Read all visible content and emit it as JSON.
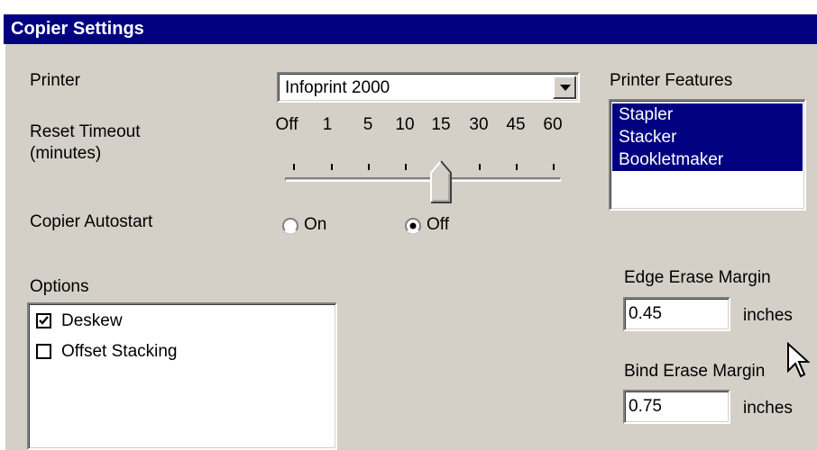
{
  "window": {
    "title": "Copier Settings"
  },
  "printer": {
    "label": "Printer",
    "selected": "Infoprint 2000"
  },
  "reset_timeout": {
    "label_line1": "Reset Timeout",
    "label_line2": "(minutes)",
    "ticks": [
      "Off",
      "1",
      "5",
      "10",
      "15",
      "30",
      "45",
      "60"
    ],
    "selected": "15"
  },
  "autostart": {
    "label": "Copier Autostart",
    "options": [
      {
        "label": "On",
        "selected": false
      },
      {
        "label": "Off",
        "selected": true
      }
    ]
  },
  "features": {
    "label": "Printer Features",
    "items": [
      "Stapler",
      "Stacker",
      "Bookletmaker"
    ]
  },
  "options": {
    "label": "Options",
    "items": [
      {
        "label": "Deskew",
        "checked": true
      },
      {
        "label": "Offset Stacking",
        "checked": false
      }
    ]
  },
  "edge_erase": {
    "label": "Edge Erase Margin",
    "value": "0.45",
    "unit": "inches"
  },
  "bind_erase": {
    "label": "Bind Erase Margin",
    "value": "0.75",
    "unit": "inches"
  },
  "colors": {
    "titlebar": "#000080",
    "face": "#d4d0c8",
    "selection": "#000080"
  }
}
